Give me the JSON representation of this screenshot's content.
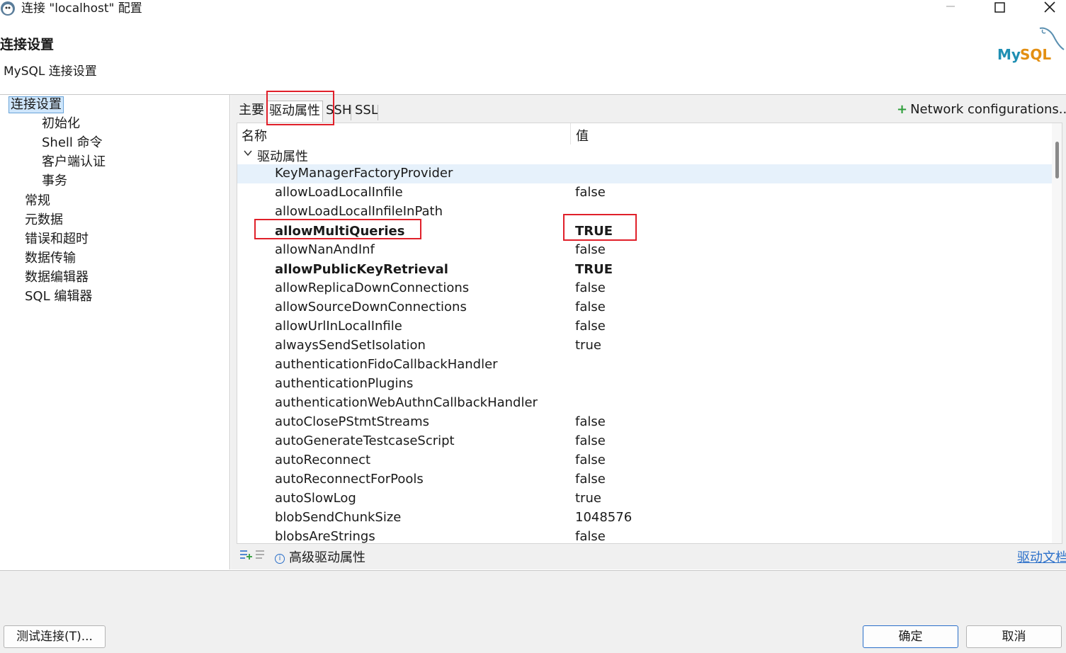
{
  "window": {
    "title": "连接 \"localhost\" 配置"
  },
  "header": {
    "title": "连接设置",
    "subtitle": "MySQL 连接设置",
    "logo_text": "MySQL"
  },
  "sidebar": {
    "items": [
      {
        "label": "连接设置",
        "level": 0,
        "selected": true
      },
      {
        "label": "初始化",
        "level": 1
      },
      {
        "label": "Shell 命令",
        "level": 1
      },
      {
        "label": "客户端认证",
        "level": 1
      },
      {
        "label": "事务",
        "level": 1
      },
      {
        "label": "常规",
        "level": 0
      },
      {
        "label": "元数据",
        "level": 0
      },
      {
        "label": "错误和超时",
        "level": 0
      },
      {
        "label": "数据传输",
        "level": 0
      },
      {
        "label": "数据编辑器",
        "level": 0
      },
      {
        "label": "SQL 编辑器",
        "level": 0
      }
    ]
  },
  "tabs": [
    {
      "label": "主要"
    },
    {
      "label": "驱动属性",
      "active": true
    },
    {
      "label": "SSH"
    },
    {
      "label": "SSL"
    }
  ],
  "network_config": {
    "icon": "plus-icon",
    "label": "Network configurations..."
  },
  "grid": {
    "col_name": "名称",
    "col_value": "值",
    "group_label": "驱动属性",
    "rows": [
      {
        "name": "KeyManagerFactoryProvider",
        "value": ""
      },
      {
        "name": "allowLoadLocalInfile",
        "value": "false"
      },
      {
        "name": "allowLoadLocalInfileInPath",
        "value": ""
      },
      {
        "name": "allowMultiQueries",
        "value": "TRUE"
      },
      {
        "name": "allowNanAndInf",
        "value": "false"
      },
      {
        "name": "allowPublicKeyRetrieval",
        "value": "TRUE"
      },
      {
        "name": "allowReplicaDownConnections",
        "value": "false"
      },
      {
        "name": "allowSourceDownConnections",
        "value": "false"
      },
      {
        "name": "allowUrlInLocalInfile",
        "value": "false"
      },
      {
        "name": "alwaysSendSetIsolation",
        "value": "true"
      },
      {
        "name": "authenticationFidoCallbackHandler",
        "value": ""
      },
      {
        "name": "authenticationPlugins",
        "value": ""
      },
      {
        "name": "authenticationWebAuthnCallbackHandler",
        "value": ""
      },
      {
        "name": "autoClosePStmtStreams",
        "value": "false"
      },
      {
        "name": "autoGenerateTestcaseScript",
        "value": "false"
      },
      {
        "name": "autoReconnect",
        "value": "false"
      },
      {
        "name": "autoReconnectForPools",
        "value": "false"
      },
      {
        "name": "autoSlowLog",
        "value": "true"
      },
      {
        "name": "blobSendChunkSize",
        "value": "1048576"
      },
      {
        "name": "blobsAreStrings",
        "value": "false"
      }
    ]
  },
  "bottom_tools": {
    "advanced_label": "高级驱动属性",
    "doc_link": "驱动文档"
  },
  "footer": {
    "test_button": "测试连接(T)...",
    "ok_button": "确定",
    "cancel_button": "取消"
  },
  "colors": {
    "accent": "#2a6fc9",
    "annotation_red": "#e0202a",
    "selection_bg": "#cfe6fb"
  }
}
